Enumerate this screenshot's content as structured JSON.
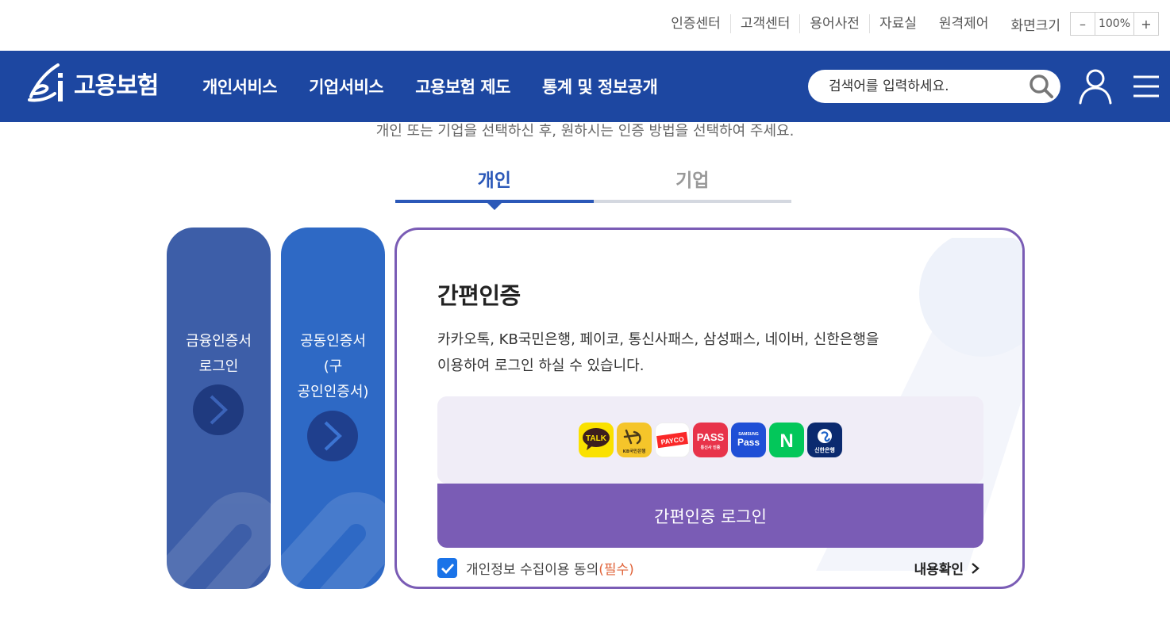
{
  "utility": {
    "links": [
      "인증센터",
      "고객센터",
      "용어사전",
      "자료실",
      "원격제어"
    ],
    "zoom_label": "화면크기",
    "zoom_minus": "–",
    "zoom_value": "100%",
    "zoom_plus": "+"
  },
  "nav": {
    "logo_text": "고용보험",
    "menu": [
      "개인서비스",
      "기업서비스",
      "고용보험 제도",
      "통계 및 정보공개"
    ],
    "search_placeholder": "검색어를 입력하세요."
  },
  "content": {
    "instruction": "개인 또는 기업을 선택하신 후, 원하시는 인증 방법을 선택하여 주세요.",
    "tabs": [
      {
        "label": "개인",
        "active": true
      },
      {
        "label": "기업",
        "active": false
      }
    ],
    "cards": [
      {
        "line1": "금융인증서",
        "line2": "로그인"
      },
      {
        "line1": "공동인증서",
        "line2": "(구",
        "line3": "공인인증서)"
      }
    ],
    "panel": {
      "title": "간편인증",
      "desc_line1": "카카오톡, KB국민은행, 페이코, 통신사패스, 삼성패스, 네이버, 신한은행을",
      "desc_line2": "이용하여 로그인 하실 수 있습니다.",
      "providers": [
        {
          "name": "kakaotalk-logo",
          "text": "TALK",
          "color": "#fae100"
        },
        {
          "name": "kb-logo",
          "text": "KB국민은행",
          "color": "#f5c52a"
        },
        {
          "name": "payco-logo",
          "text": "PAYCO",
          "color": "#ffffff"
        },
        {
          "name": "pass-logo",
          "text": "PASS",
          "subtext": "통신사 인증",
          "color": "#e8334a"
        },
        {
          "name": "samsung-pass-logo",
          "text": "Pass",
          "subtext": "SAMSUNG",
          "color": "#1f4fd6"
        },
        {
          "name": "naver-logo",
          "text": "N",
          "color": "#03c75a"
        },
        {
          "name": "shinhan-logo",
          "text": "신한은행",
          "color": "#0b2a6f"
        }
      ],
      "login_button": "간편인증 로그인",
      "agree_text": "개인정보 수집이용 동의",
      "agree_required": "(필수)",
      "agree_checked": true,
      "detail_link": "내용확인"
    }
  }
}
